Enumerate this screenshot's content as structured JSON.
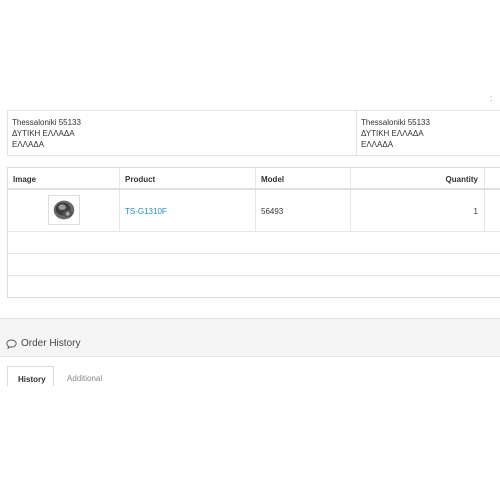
{
  "addresses": {
    "left": {
      "line1": "Thessaloniki 55133",
      "line2": "ΔΥΤΙΚΗ ΕΛΛΑΔΑ",
      "line3": "ΕΛΛΑΔΑ"
    },
    "right": {
      "line1": "Thessaloniki 55133",
      "line2": "ΔΥΤΙΚΗ ΕΛΛΑΔΑ",
      "line3": "ΕΛΛΑΔΑ"
    }
  },
  "table": {
    "headers": {
      "image": "Image",
      "product": "Product",
      "model": "Model",
      "quantity": "Quantity"
    },
    "rows": [
      {
        "product": "TS-G1310F",
        "model": "56493",
        "quantity": "1",
        "image_icon": "speaker-product-thumbnail"
      }
    ],
    "stray_mark": ":"
  },
  "history": {
    "title": "Order History",
    "icon": "comment-icon",
    "tabs": {
      "active": "History",
      "inactive": "Additional"
    }
  }
}
